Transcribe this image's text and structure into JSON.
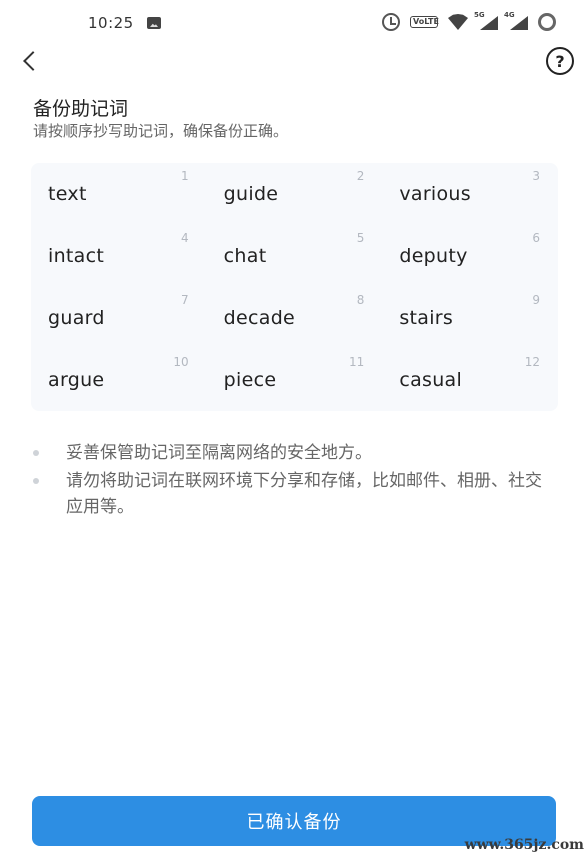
{
  "status_bar": {
    "time": "10:25",
    "volte_label": "VoLTE",
    "signal1_label": "5G",
    "signal2_label": "4G",
    "icons": [
      "gallery-icon",
      "alarm-icon",
      "volte-icon",
      "wifi-icon",
      "signal-icon",
      "signal-icon",
      "battery-ring-icon"
    ]
  },
  "header": {
    "back_icon": "chevron-left",
    "help_label": "?"
  },
  "title": "备份助记词",
  "subtitle": "请按顺序抄写助记词，确保备份正确。",
  "mnemonic": [
    {
      "index": "1",
      "word": "text"
    },
    {
      "index": "2",
      "word": "guide"
    },
    {
      "index": "3",
      "word": "various"
    },
    {
      "index": "4",
      "word": "intact"
    },
    {
      "index": "5",
      "word": "chat"
    },
    {
      "index": "6",
      "word": "deputy"
    },
    {
      "index": "7",
      "word": "guard"
    },
    {
      "index": "8",
      "word": "decade"
    },
    {
      "index": "9",
      "word": "stairs"
    },
    {
      "index": "10",
      "word": "argue"
    },
    {
      "index": "11",
      "word": "piece"
    },
    {
      "index": "12",
      "word": "casual"
    }
  ],
  "tips": [
    "妥善保管助记词至隔离网络的安全地方。",
    "请勿将助记词在联网环境下分享和存储，比如邮件、相册、社交应用等。"
  ],
  "confirm_label": "已确认备份",
  "watermark": "www.365jz.com",
  "colors": {
    "primary": "#2d8ee3",
    "grid_bg": "#f7f9fc",
    "index_text": "#b3b8c0"
  }
}
